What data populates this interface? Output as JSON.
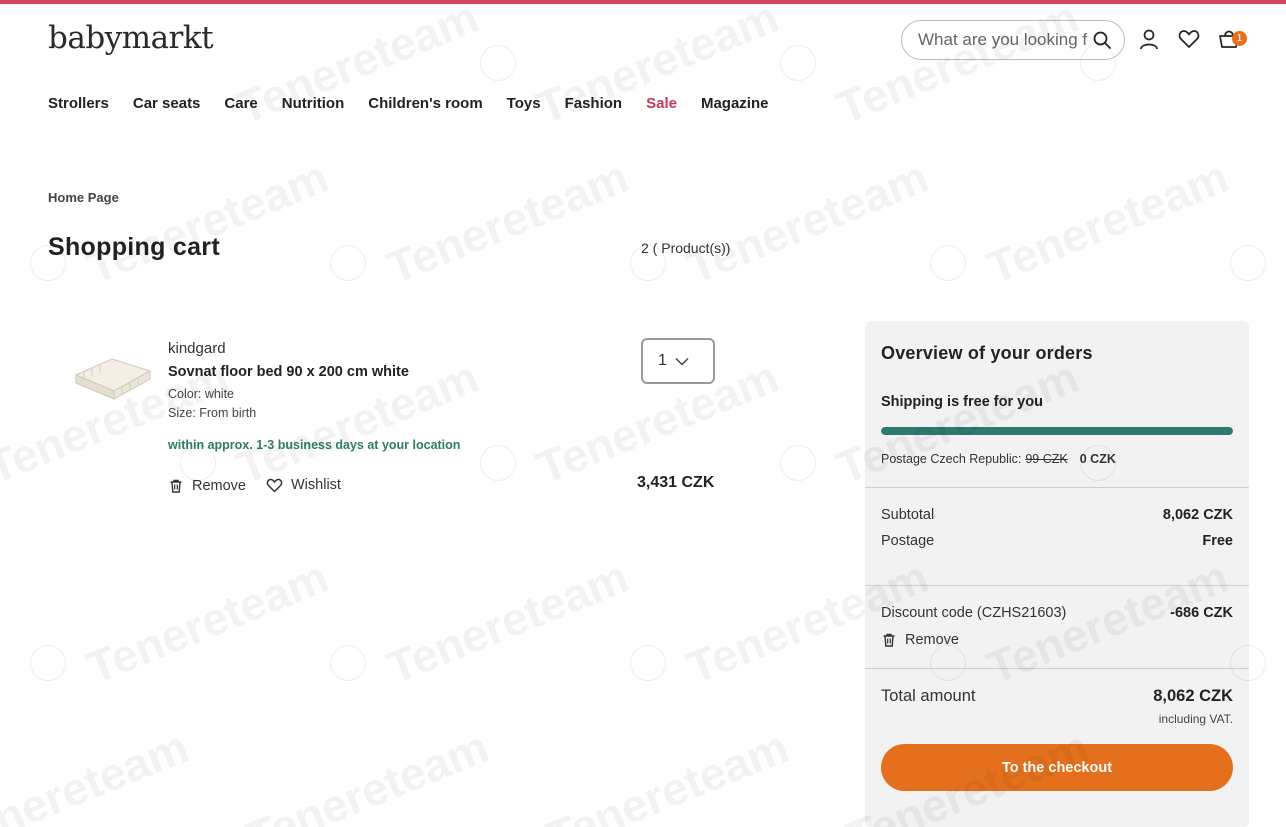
{
  "header": {
    "logo": "babymarkt",
    "search_placeholder": "What are you looking for?",
    "cart_badge": "1"
  },
  "nav": {
    "items": [
      "Strollers",
      "Car seats",
      "Care",
      "Nutrition",
      "Children's room",
      "Toys",
      "Fashion",
      "Sale",
      "Magazine"
    ]
  },
  "breadcrumb": "Home Page",
  "page": {
    "title": "Shopping cart",
    "count": "2 ( Product(s))"
  },
  "product": {
    "brand": "kindgard",
    "name": "Sovnat floor bed 90 x 200 cm white",
    "color": "Color: white",
    "size": "Size: From birth",
    "delivery": "within approx. 1-3 business days at your location",
    "remove_label": "Remove",
    "wishlist_label": "Wishlist",
    "quantity": "1",
    "price": "3,431 CZK"
  },
  "summary": {
    "title": "Overview of your orders",
    "shipping_free": "Shipping is free for you",
    "shipping_progress": 1.0,
    "postage_label": "Postage Czech Republic:",
    "postage_old": "99 CZK",
    "postage_new": "0 CZK",
    "subtotal_label": "Subtotal",
    "subtotal_value": "8,062 CZK",
    "postage_row_label": "Postage",
    "postage_row_value": "Free",
    "discount_label": "Discount code (CZHS21603)",
    "discount_value": "-686 CZK",
    "discount_remove": "Remove",
    "total_label": "Total amount",
    "total_value": "8,062 CZK",
    "vat_note": "including VAT.",
    "checkout_label": "To the checkout"
  },
  "colors": {
    "accent_bar": "#d7445f",
    "sale": "#c8385a",
    "delivery": "#2e7d62",
    "progress": "#2f7a6e",
    "checkout": "#e4701e"
  },
  "watermark": "Tenereteam"
}
